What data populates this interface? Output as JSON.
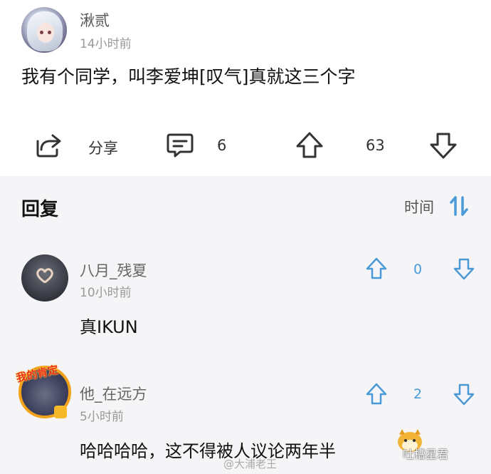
{
  "post": {
    "username": "湫贰",
    "time": "14小时前",
    "text": "我有个同学，叫李爱坤[叹气]真就这三个字",
    "share_label": "分享",
    "comment_count": "6",
    "like_count": "63",
    "icons": [
      "share-icon",
      "comment-icon",
      "upvote-icon",
      "downvote-icon"
    ]
  },
  "replies": {
    "title": "回复",
    "sort_label": "时间",
    "items": [
      {
        "username": "八月_残夏",
        "time": "10小时前",
        "text": "真IKUN",
        "vote_count": "0"
      },
      {
        "username": "他_在远方",
        "time": "5小时前",
        "text": "哈哈哈哈，这不得被人议论两年半",
        "vote_count": "2",
        "badge": "我的肯定"
      }
    ]
  },
  "watermark": {
    "left": "@大浦老王",
    "right": "吐槽星君"
  },
  "colors": {
    "accent": "#4a9ad8",
    "background_replies": "#f5f5f7",
    "text": "#111111"
  }
}
